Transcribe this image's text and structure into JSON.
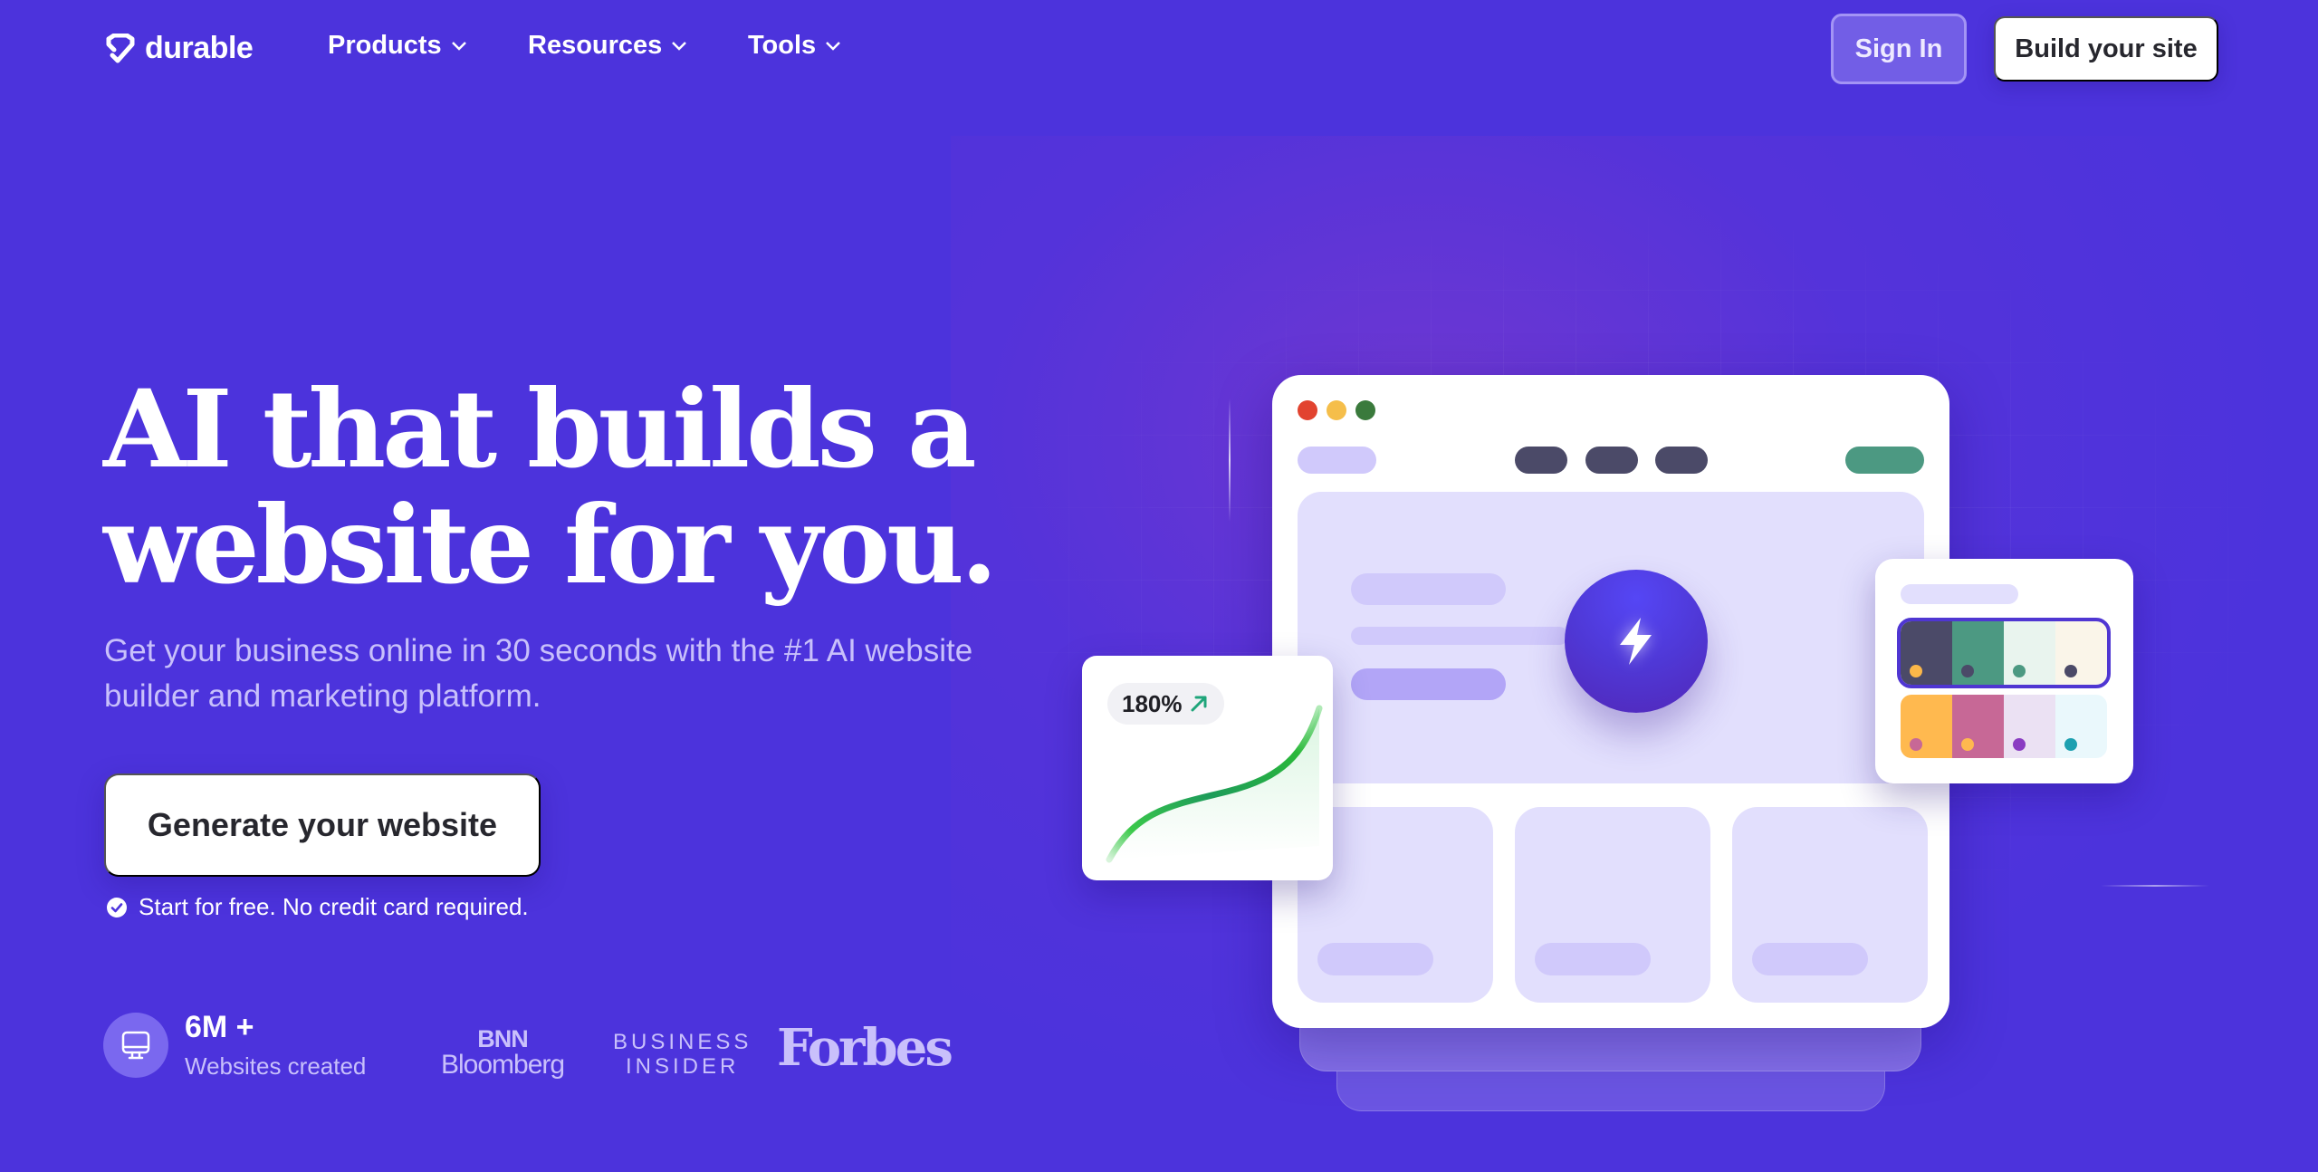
{
  "nav": {
    "brand": "durable",
    "items": [
      {
        "label": "Products",
        "icon": "chevron-down-icon"
      },
      {
        "label": "Resources",
        "icon": "chevron-down-icon"
      },
      {
        "label": "Tools",
        "icon": "chevron-down-icon"
      }
    ],
    "sign_in": "Sign In",
    "build_site": "Build your site"
  },
  "hero": {
    "headline_line1": "AI that builds a",
    "headline_line2": "website for you.",
    "subtext": "Get your business online in 30 seconds with the #1 AI website builder and marketing platform.",
    "cta": "Generate your website",
    "note": "Start for free. No credit card required.",
    "note_icon": "check-circle-icon"
  },
  "stats": {
    "icon": "monitor-icon",
    "value": "6M +",
    "label": "Websites created"
  },
  "press": {
    "bnn_line1": "BNN",
    "bnn_line2": "Bloomberg",
    "bi_line1": "BUSINESS",
    "bi_line2": "INSIDER",
    "forbes": "Forbes"
  },
  "illustration": {
    "growth_badge": "180%",
    "growth_icon": "arrow-up-right-icon",
    "center_icon": "lightning-bolt-icon",
    "colors": {
      "accent": "#4c33dc",
      "traffic_red": "#e2432f",
      "traffic_yellow": "#f5be4a",
      "traffic_green": "#3a7a3c",
      "nav_dark": "#4b4a68",
      "nav_green": "#4c9982",
      "growth_green": "#22b34a"
    },
    "palettes": [
      {
        "selected": true,
        "swatches": [
          "#4b4a68",
          "#4c9982",
          "#e9f4ee",
          "#faf5e9"
        ],
        "dots": [
          "#fbb749",
          "#4b4a68",
          "#4c9982",
          "#4b4a68"
        ]
      },
      {
        "selected": false,
        "swatches": [
          "#ffb94f",
          "#c76896",
          "#ebe1f3",
          "#eaf8fc"
        ],
        "dots": [
          "#c76896",
          "#ffb94f",
          "#8a3cc2",
          "#1da0b0"
        ]
      }
    ]
  }
}
